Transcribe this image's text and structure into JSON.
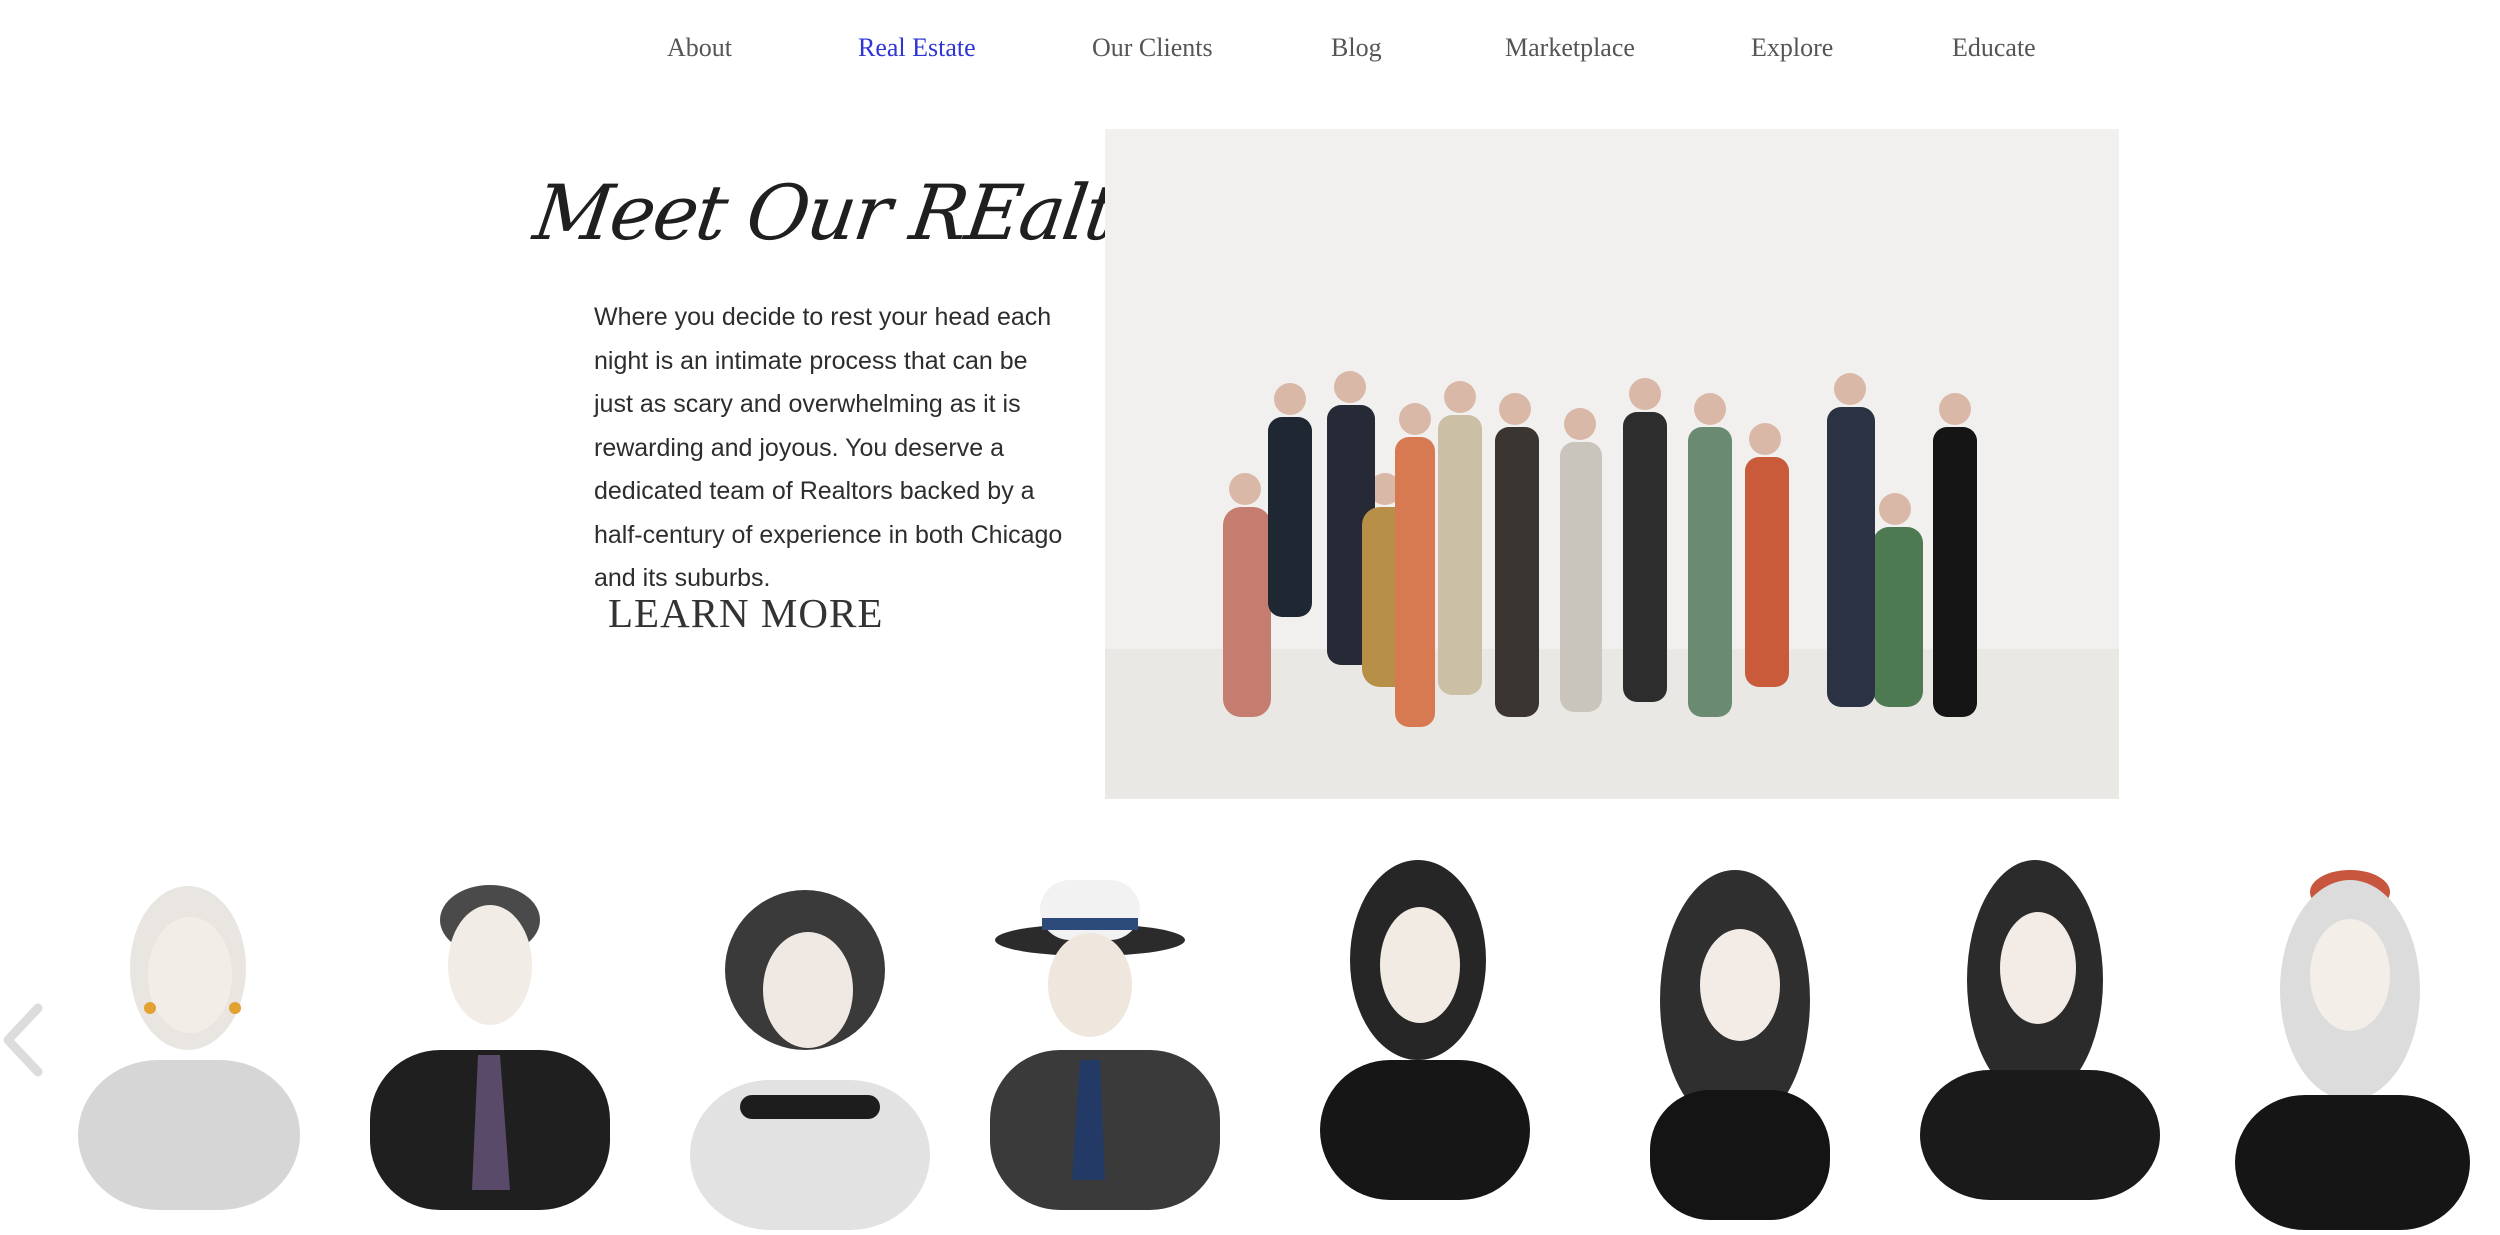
{
  "nav": {
    "items": [
      {
        "label": "About"
      },
      {
        "label": "Real Estate",
        "active": true
      },
      {
        "label": "Our Clients"
      },
      {
        "label": "Blog"
      },
      {
        "label": "Marketplace"
      },
      {
        "label": "Explore"
      },
      {
        "label": "Educate"
      }
    ]
  },
  "hero": {
    "title": "Meet Our REaltors",
    "paragraph": "Where you decide to rest your head each night is an intimate process that can be just as scary and overwhelming as it is rewarding and joyous. You deserve a dedicated team of Realtors backed by a half-century of experience in both Chicago and its suburbs.",
    "cta": "LEARN MORE"
  },
  "colors": {
    "accent": "#2f34d4",
    "text": "#2d2d2d"
  },
  "gallery": {
    "prev_icon": "chevron-left-icon"
  }
}
